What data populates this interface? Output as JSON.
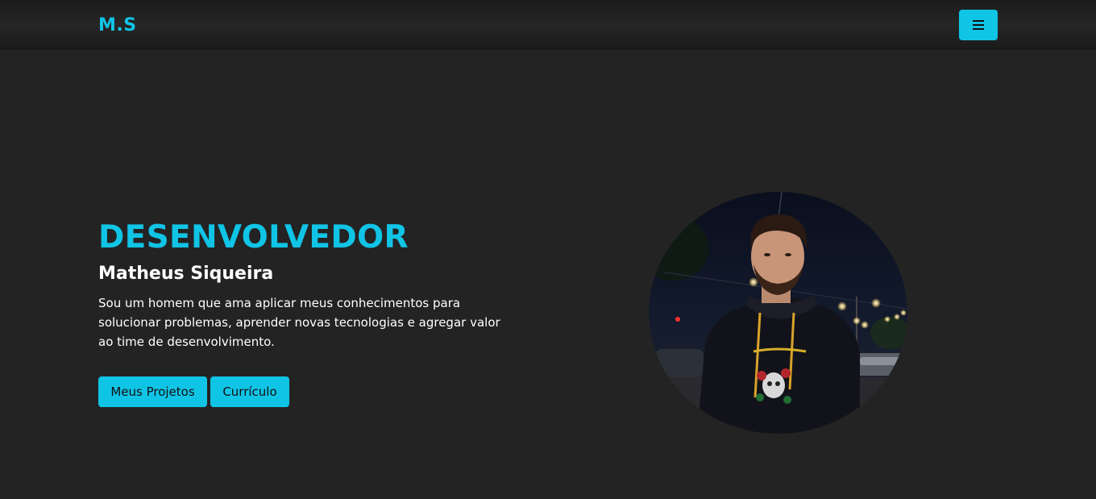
{
  "navbar": {
    "brand": "M.S",
    "menu_icon": "hamburger-menu-icon"
  },
  "hero": {
    "title": "DESENVOLVEDOR",
    "name": "Matheus Siqueira",
    "description": "Sou um homem que ama aplicar meus conhecimentos para solucionar problemas, aprender novas tecnologias e agregar valor ao time de desenvolvimento.",
    "buttons": {
      "projects": "Meus Projetos",
      "resume": "Currículo"
    }
  },
  "colors": {
    "accent": "#10c4e6",
    "background": "#232323",
    "navbar": "#1e1e1e",
    "text": "#ffffff"
  }
}
